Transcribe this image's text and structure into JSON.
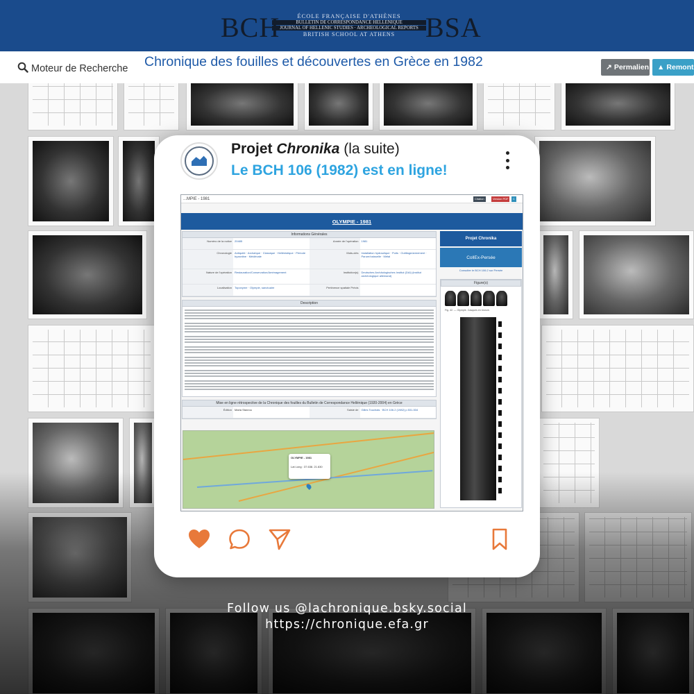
{
  "banner": {
    "logo_left": "BCH",
    "logo_right": "BSA",
    "line1": "ÉCOLE FRANÇAISE D'ATHÈNES",
    "line2": "BULLETIN DE CORRESPONDANCE HELLÉNIQUE",
    "line3": "JOURNAL OF HELLENIC STUDIES · ARCHEOLOGICAL REPORTS",
    "line4": "BRITISH SCHOOL AT ATHENS"
  },
  "header": {
    "search_label": "Moteur de Recherche",
    "title": "Chronique des fouilles et découvertes en Grèce en 1982",
    "permalien_label": "Permalien",
    "remonter_label": "Remonter"
  },
  "post": {
    "title_prefix": "Projet ",
    "title_em": "Chronika",
    "title_suffix": " (la suite)",
    "subtitle": "Le BCH 106 (1982) est en ligne!",
    "accent_color": "#2ea4e0",
    "like_color": "#e8793a"
  },
  "screenshot": {
    "breadcrumb": "...MPIE - 1981",
    "btn_citation": "Citation",
    "btn_pdf": "Version PDF",
    "btn_x": "C",
    "page_title": "OLYMPIE - 1981",
    "info_head": "Informations Générales",
    "rows": [
      {
        "k1": "Numéro de la notice",
        "v1": "20485",
        "k2": "Année de l'opération",
        "v2": "1981"
      },
      {
        "k1": "Chronologie",
        "v1": "Antiquité · Archaïque · Classique · Hellénistique · Période byzantine · Médiévale",
        "k2": "Mots-clés",
        "v2": "Installation hydraulique · Puits · Outillage/armement · Parure/vaisselle · Métal"
      },
      {
        "k1": "Nature de l'opération",
        "v1": "Restauration/Conservation/Aménagement",
        "k2": "Institution(s)",
        "v2": "Deutsches Archäologisches Institut (DAI) (institut archéologique allemand)"
      },
      {
        "k1": "Localisation",
        "v1": "Toponyme · Olympie, sanctuaire",
        "k2": "Pertinence spatiale Précis",
        "v2": ""
      }
    ],
    "desc_head": "Description",
    "edition_head": "Mise en ligne rétrospective de la Chronique des fouilles du Bulletin de Correspondance Hellénique (1920-2004) en Grèce",
    "edition_label": "Édition",
    "edition_value": "Maria Stavrou",
    "saisie_label": "Saisie de",
    "saisie_value": "Gilles Touchais · BCH 106.2 (1982) p.531-534",
    "map_popup_title": "OLYMPIE - 1981",
    "map_popup_coords": "Lat Long : 37.638. 21.630",
    "side_button": "Projet Chronika",
    "persee_label": "CollEx-Persée",
    "persee_link": "Consulter le BCH 106.2 sur Persée",
    "figure_head": "Figure(s)",
    "figure_caption": "Fig. 42. — Olympie. Casques en bronze."
  },
  "footer": {
    "follow": "Follow us @lachronique.bsky.social",
    "url": "https://chronique.efa.gr"
  }
}
